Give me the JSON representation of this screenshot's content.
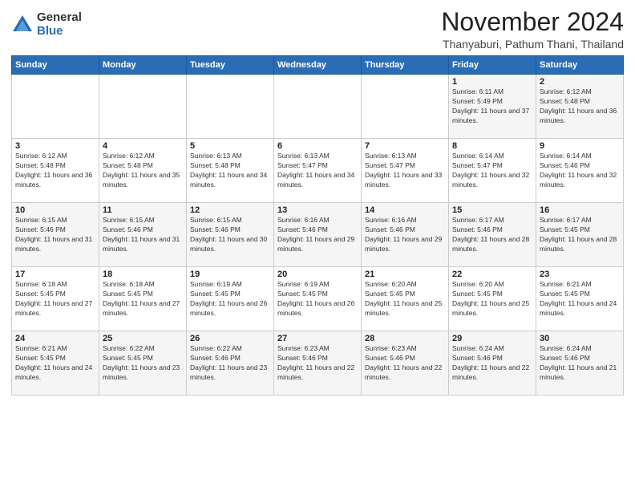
{
  "logo": {
    "general": "General",
    "blue": "Blue"
  },
  "title": "November 2024",
  "location": "Thanyaburi, Pathum Thani, Thailand",
  "weekdays": [
    "Sunday",
    "Monday",
    "Tuesday",
    "Wednesday",
    "Thursday",
    "Friday",
    "Saturday"
  ],
  "weeks": [
    [
      {
        "day": null,
        "sunrise": null,
        "sunset": null,
        "daylight": null
      },
      {
        "day": null,
        "sunrise": null,
        "sunset": null,
        "daylight": null
      },
      {
        "day": null,
        "sunrise": null,
        "sunset": null,
        "daylight": null
      },
      {
        "day": null,
        "sunrise": null,
        "sunset": null,
        "daylight": null
      },
      {
        "day": null,
        "sunrise": null,
        "sunset": null,
        "daylight": null
      },
      {
        "day": "1",
        "sunrise": "Sunrise: 6:11 AM",
        "sunset": "Sunset: 5:49 PM",
        "daylight": "Daylight: 11 hours and 37 minutes."
      },
      {
        "day": "2",
        "sunrise": "Sunrise: 6:12 AM",
        "sunset": "Sunset: 5:48 PM",
        "daylight": "Daylight: 11 hours and 36 minutes."
      }
    ],
    [
      {
        "day": "3",
        "sunrise": "Sunrise: 6:12 AM",
        "sunset": "Sunset: 5:48 PM",
        "daylight": "Daylight: 11 hours and 36 minutes."
      },
      {
        "day": "4",
        "sunrise": "Sunrise: 6:12 AM",
        "sunset": "Sunset: 5:48 PM",
        "daylight": "Daylight: 11 hours and 35 minutes."
      },
      {
        "day": "5",
        "sunrise": "Sunrise: 6:13 AM",
        "sunset": "Sunset: 5:48 PM",
        "daylight": "Daylight: 11 hours and 34 minutes."
      },
      {
        "day": "6",
        "sunrise": "Sunrise: 6:13 AM",
        "sunset": "Sunset: 5:47 PM",
        "daylight": "Daylight: 11 hours and 34 minutes."
      },
      {
        "day": "7",
        "sunrise": "Sunrise: 6:13 AM",
        "sunset": "Sunset: 5:47 PM",
        "daylight": "Daylight: 11 hours and 33 minutes."
      },
      {
        "day": "8",
        "sunrise": "Sunrise: 6:14 AM",
        "sunset": "Sunset: 5:47 PM",
        "daylight": "Daylight: 11 hours and 32 minutes."
      },
      {
        "day": "9",
        "sunrise": "Sunrise: 6:14 AM",
        "sunset": "Sunset: 5:46 PM",
        "daylight": "Daylight: 11 hours and 32 minutes."
      }
    ],
    [
      {
        "day": "10",
        "sunrise": "Sunrise: 6:15 AM",
        "sunset": "Sunset: 5:46 PM",
        "daylight": "Daylight: 11 hours and 31 minutes."
      },
      {
        "day": "11",
        "sunrise": "Sunrise: 6:15 AM",
        "sunset": "Sunset: 5:46 PM",
        "daylight": "Daylight: 11 hours and 31 minutes."
      },
      {
        "day": "12",
        "sunrise": "Sunrise: 6:15 AM",
        "sunset": "Sunset: 5:46 PM",
        "daylight": "Daylight: 11 hours and 30 minutes."
      },
      {
        "day": "13",
        "sunrise": "Sunrise: 6:16 AM",
        "sunset": "Sunset: 5:46 PM",
        "daylight": "Daylight: 11 hours and 29 minutes."
      },
      {
        "day": "14",
        "sunrise": "Sunrise: 6:16 AM",
        "sunset": "Sunset: 5:46 PM",
        "daylight": "Daylight: 11 hours and 29 minutes."
      },
      {
        "day": "15",
        "sunrise": "Sunrise: 6:17 AM",
        "sunset": "Sunset: 5:46 PM",
        "daylight": "Daylight: 11 hours and 28 minutes."
      },
      {
        "day": "16",
        "sunrise": "Sunrise: 6:17 AM",
        "sunset": "Sunset: 5:45 PM",
        "daylight": "Daylight: 11 hours and 28 minutes."
      }
    ],
    [
      {
        "day": "17",
        "sunrise": "Sunrise: 6:18 AM",
        "sunset": "Sunset: 5:45 PM",
        "daylight": "Daylight: 11 hours and 27 minutes."
      },
      {
        "day": "18",
        "sunrise": "Sunrise: 6:18 AM",
        "sunset": "Sunset: 5:45 PM",
        "daylight": "Daylight: 11 hours and 27 minutes."
      },
      {
        "day": "19",
        "sunrise": "Sunrise: 6:19 AM",
        "sunset": "Sunset: 5:45 PM",
        "daylight": "Daylight: 11 hours and 26 minutes."
      },
      {
        "day": "20",
        "sunrise": "Sunrise: 6:19 AM",
        "sunset": "Sunset: 5:45 PM",
        "daylight": "Daylight: 11 hours and 26 minutes."
      },
      {
        "day": "21",
        "sunrise": "Sunrise: 6:20 AM",
        "sunset": "Sunset: 5:45 PM",
        "daylight": "Daylight: 11 hours and 25 minutes."
      },
      {
        "day": "22",
        "sunrise": "Sunrise: 6:20 AM",
        "sunset": "Sunset: 5:45 PM",
        "daylight": "Daylight: 11 hours and 25 minutes."
      },
      {
        "day": "23",
        "sunrise": "Sunrise: 6:21 AM",
        "sunset": "Sunset: 5:45 PM",
        "daylight": "Daylight: 11 hours and 24 minutes."
      }
    ],
    [
      {
        "day": "24",
        "sunrise": "Sunrise: 6:21 AM",
        "sunset": "Sunset: 5:45 PM",
        "daylight": "Daylight: 11 hours and 24 minutes."
      },
      {
        "day": "25",
        "sunrise": "Sunrise: 6:22 AM",
        "sunset": "Sunset: 5:45 PM",
        "daylight": "Daylight: 11 hours and 23 minutes."
      },
      {
        "day": "26",
        "sunrise": "Sunrise: 6:22 AM",
        "sunset": "Sunset: 5:46 PM",
        "daylight": "Daylight: 11 hours and 23 minutes."
      },
      {
        "day": "27",
        "sunrise": "Sunrise: 6:23 AM",
        "sunset": "Sunset: 5:46 PM",
        "daylight": "Daylight: 11 hours and 22 minutes."
      },
      {
        "day": "28",
        "sunrise": "Sunrise: 6:23 AM",
        "sunset": "Sunset: 5:46 PM",
        "daylight": "Daylight: 11 hours and 22 minutes."
      },
      {
        "day": "29",
        "sunrise": "Sunrise: 6:24 AM",
        "sunset": "Sunset: 5:46 PM",
        "daylight": "Daylight: 11 hours and 22 minutes."
      },
      {
        "day": "30",
        "sunrise": "Sunrise: 6:24 AM",
        "sunset": "Sunset: 5:46 PM",
        "daylight": "Daylight: 11 hours and 21 minutes."
      }
    ]
  ]
}
